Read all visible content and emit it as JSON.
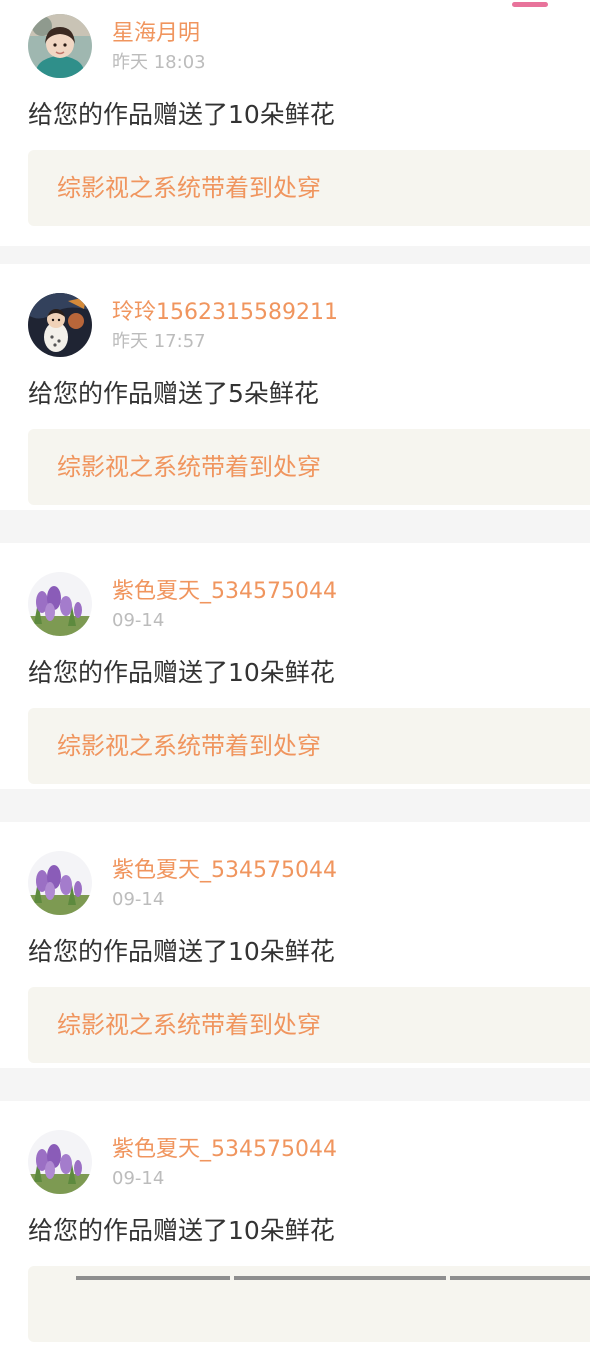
{
  "notifications": [
    {
      "username": "星海月明",
      "time": "昨天 18:03",
      "message": "给您的作品赠送了10朵鲜花",
      "work_title": "综影视之系统带着到处穿"
    },
    {
      "username": "玲玲1562315589211",
      "time": "昨天 17:57",
      "message": "给您的作品赠送了5朵鲜花",
      "work_title": "综影视之系统带着到处穿"
    },
    {
      "username": "紫色夏天_534575044",
      "time": "09-14",
      "message": "给您的作品赠送了10朵鲜花",
      "work_title": "综影视之系统带着到处穿"
    },
    {
      "username": "紫色夏天_534575044",
      "time": "09-14",
      "message": "给您的作品赠送了10朵鲜花",
      "work_title": "综影视之系统带着到处穿"
    },
    {
      "username": "紫色夏天_534575044",
      "time": "09-14",
      "message": "给您的作品赠送了10朵鲜花",
      "work_title": ""
    }
  ],
  "colors": {
    "accent": "#f0955e",
    "tab_indicator": "#e8739b",
    "page_background": "#f5f5f5",
    "card_background": "#ffffff",
    "work_box_background": "#f6f5ef",
    "message_text": "#333333",
    "time_text": "#bcbcbc"
  },
  "icons": {
    "avatar_1": "girl-photo-avatar",
    "avatar_2": "baby-photo-avatar",
    "avatar_3": "crocus-flower-avatar"
  }
}
